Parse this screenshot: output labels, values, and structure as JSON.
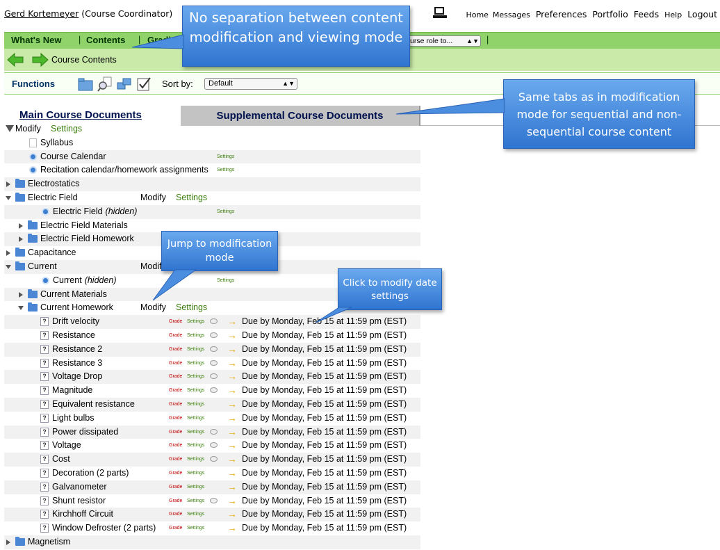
{
  "header": {
    "user_name": "Gerd Kortemeyer",
    "user_role": "(Course Coordinator)",
    "nav": [
      "Home",
      "Messages",
      "Preferences",
      "Portfolio",
      "Feeds",
      "Help",
      "Logout"
    ]
  },
  "tabs": {
    "whats_new": "What's New",
    "contents": "Contents",
    "grades": "Gradin",
    "role_select": "urse role to..."
  },
  "breadcrumb": {
    "label": "Course Contents"
  },
  "functions": {
    "label": "Functions",
    "sort_by_label": "Sort by:",
    "sort_value": "Default"
  },
  "doc_tabs": {
    "main": "Main Course Documents",
    "supplemental": "Supplemental Course Documents"
  },
  "top_modify": {
    "modify": "Modify",
    "settings": "Settings"
  },
  "tree": [
    {
      "label": "Syllabus",
      "type": "page",
      "indent": 1
    },
    {
      "label": "Course Calendar",
      "type": "resource",
      "indent": 1,
      "settings": "Settings"
    },
    {
      "label": "Recitation calendar/homework assignments",
      "type": "resource",
      "indent": 1,
      "settings": "Settings"
    },
    {
      "label": "Electrostatics",
      "type": "folder",
      "state": "closed",
      "indent": 0
    },
    {
      "label": "Electric Field",
      "type": "folder",
      "state": "open",
      "indent": 0,
      "modify": "Modify",
      "settings_big": "Settings"
    },
    {
      "label": "Electric Field",
      "hidden": "(hidden)",
      "type": "resource",
      "indent": 2,
      "settings": "Settings"
    },
    {
      "label": "Electric Field Materials",
      "type": "folder",
      "state": "closed",
      "indent": 1
    },
    {
      "label": "Electric Field Homework",
      "type": "folder",
      "state": "closed",
      "indent": 1
    },
    {
      "label": "Capacitance",
      "type": "folder",
      "state": "closed",
      "indent": 0
    },
    {
      "label": "Current",
      "type": "folder",
      "state": "open",
      "indent": 0,
      "modify": "Modif"
    },
    {
      "label": "Current",
      "hidden": "(hidden)",
      "type": "resource",
      "indent": 2,
      "settings": "Settings"
    },
    {
      "label": "Current Materials",
      "type": "folder",
      "state": "closed",
      "indent": 1
    },
    {
      "label": "Current Homework",
      "type": "folder",
      "state": "open",
      "indent": 1,
      "modify": "Modify",
      "settings_big": "Settings"
    },
    {
      "label": "Drift velocity",
      "type": "problem",
      "indent": 3,
      "grade": "Grade",
      "settings": "Settings",
      "bubble": true,
      "due": "Due by Monday, Feb 15 at 11:59 pm (EST)"
    },
    {
      "label": "Resistance",
      "type": "problem",
      "indent": 3,
      "grade": "Grade",
      "settings": "Settings",
      "bubble": true,
      "due": "Due by Monday, Feb 15 at 11:59 pm (EST)"
    },
    {
      "label": "Resistance 2",
      "type": "problem",
      "indent": 3,
      "grade": "Grade",
      "settings": "Settings",
      "bubble": true,
      "due": "Due by Monday, Feb 15 at 11:59 pm (EST)"
    },
    {
      "label": "Resistance 3",
      "type": "problem",
      "indent": 3,
      "grade": "Grade",
      "settings": "Settings",
      "bubble": true,
      "due": "Due by Monday, Feb 15 at 11:59 pm (EST)"
    },
    {
      "label": "Voltage Drop",
      "type": "problem",
      "indent": 3,
      "grade": "Grade",
      "settings": "Settings",
      "bubble": true,
      "due": "Due by Monday, Feb 15 at 11:59 pm (EST)"
    },
    {
      "label": "Magnitude",
      "type": "problem",
      "indent": 3,
      "grade": "Grade",
      "settings": "Settings",
      "bubble": true,
      "due": "Due by Monday, Feb 15 at 11:59 pm (EST)"
    },
    {
      "label": "Equivalent resistance",
      "type": "problem",
      "indent": 3,
      "grade": "Grade",
      "settings": "Settings",
      "bubble": false,
      "due": "Due by Monday, Feb 15 at 11:59 pm (EST)"
    },
    {
      "label": "Light bulbs",
      "type": "problem",
      "indent": 3,
      "grade": "Grade",
      "settings": "Settings",
      "bubble": false,
      "due": "Due by Monday, Feb 15 at 11:59 pm (EST)"
    },
    {
      "label": "Power dissipated",
      "type": "problem",
      "indent": 3,
      "grade": "Grade",
      "settings": "Settings",
      "bubble": true,
      "due": "Due by Monday, Feb 15 at 11:59 pm (EST)"
    },
    {
      "label": "Voltage",
      "type": "problem",
      "indent": 3,
      "grade": "Grade",
      "settings": "Settings",
      "bubble": true,
      "due": "Due by Monday, Feb 15 at 11:59 pm (EST)"
    },
    {
      "label": "Cost",
      "type": "problem",
      "indent": 3,
      "grade": "Grade",
      "settings": "Settings",
      "bubble": true,
      "due": "Due by Monday, Feb 15 at 11:59 pm (EST)"
    },
    {
      "label": "Decoration (2 parts)",
      "type": "problem",
      "indent": 3,
      "grade": "Grade",
      "settings": "Settings",
      "bubble": false,
      "due": "Due by Monday, Feb 15 at 11:59 pm (EST)"
    },
    {
      "label": "Galvanometer",
      "type": "problem",
      "indent": 3,
      "grade": "Grade",
      "settings": "Settings",
      "bubble": false,
      "due": "Due by Monday, Feb 15 at 11:59 pm (EST)"
    },
    {
      "label": "Shunt resistor",
      "type": "problem",
      "indent": 3,
      "grade": "Grade",
      "settings": "Settings",
      "bubble": true,
      "due": "Due by Monday, Feb 15 at 11:59 pm (EST)"
    },
    {
      "label": "Kirchhoff Circuit",
      "type": "problem",
      "indent": 3,
      "grade": "Grade",
      "settings": "Settings",
      "bubble": false,
      "due": "Due by Monday, Feb 15 at 11:59 pm (EST)"
    },
    {
      "label": "Window Defroster (2 parts)",
      "type": "problem",
      "indent": 3,
      "grade": "Grade",
      "settings": "Settings",
      "bubble": false,
      "due": "Due by Monday, Feb 15 at 11:59 pm (EST)"
    },
    {
      "label": "Magnetism",
      "type": "folder",
      "state": "closed",
      "indent": 0
    }
  ],
  "callouts": {
    "no_separation": "No separation between content modification and viewing mode",
    "same_tabs": "Same tabs as in modification mode for sequential and non-sequential course content",
    "jump": "Jump to modification mode",
    "click_modify": "Click to modify date settings"
  },
  "colors": {
    "tab_bar": "#8fd36a",
    "crumb_bar": "#c9eaa9",
    "callout": "#2f74d0",
    "grade_red": "#c00000",
    "settings_green": "#3a7d0a"
  }
}
